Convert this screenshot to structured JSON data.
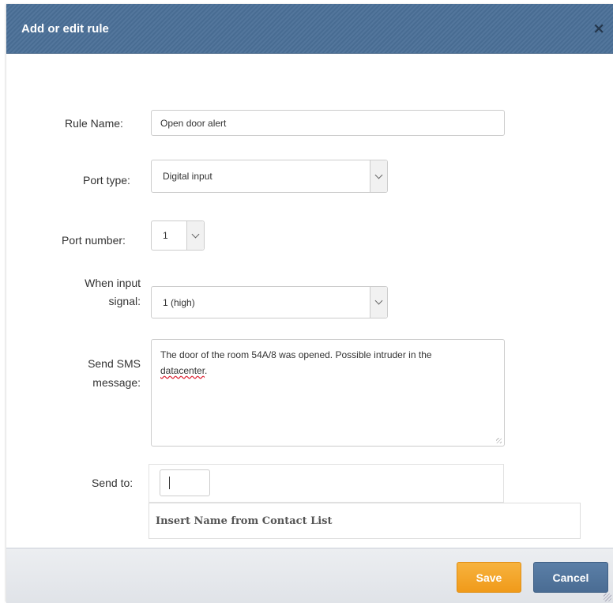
{
  "dialog": {
    "title": "Add or edit rule",
    "close_glyph": "×"
  },
  "form": {
    "rule_name": {
      "label": "Rule Name:",
      "value": "Open door alert"
    },
    "port_type": {
      "label": "Port type:",
      "value": "Digital input"
    },
    "port_number": {
      "label": "Port number:",
      "value": "1"
    },
    "input_signal": {
      "label_line1": "When input",
      "label_line2": "signal:",
      "value": "1 (high)"
    },
    "sms_message": {
      "label_line1": "Send SMS",
      "label_line2": "message:",
      "value_part1": "The door of the room 54A/8 was opened. Possible intruder in the",
      "value_part2": "datacenter",
      "value_part3": "."
    },
    "send_to": {
      "label": "Send to:",
      "value": "",
      "contact_list_hint": "Insert Name from Contact List"
    }
  },
  "footer": {
    "save_label": "Save",
    "cancel_label": "Cancel"
  },
  "colors": {
    "header": "#4a6f97",
    "save_button": "#f5a623",
    "cancel_button": "#4f7199"
  },
  "icons": {
    "close": "close-icon",
    "dropdown": "chevron-down-icon",
    "resize": "resize-grip-icon"
  }
}
